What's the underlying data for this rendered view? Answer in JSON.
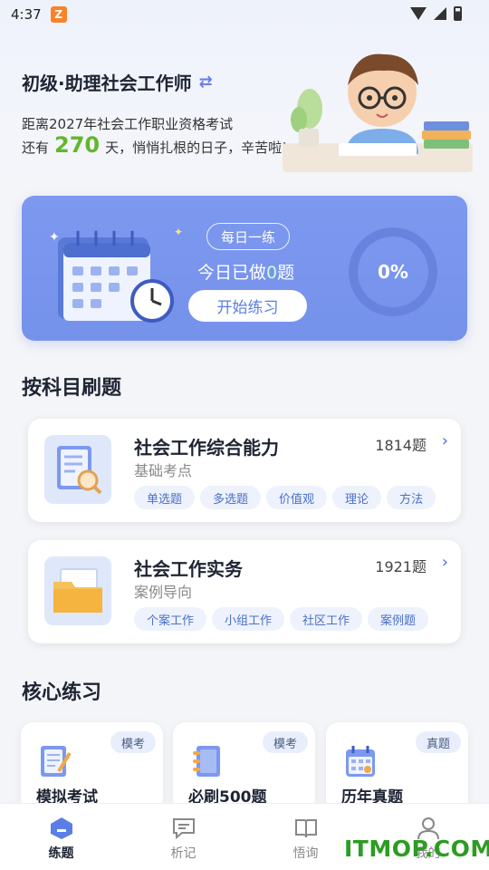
{
  "status": {
    "time": "4:37",
    "app_badge": "Z"
  },
  "header": {
    "exam_title": "初级·助理社会工作师",
    "countdown_prefix": "距离2027年社会工作职业资格考试",
    "remaining_prefix": "还有",
    "days": "270",
    "remaining_suffix": "天，悄悄扎根的日子，辛苦啦!"
  },
  "daily": {
    "tag": "每日一练",
    "done_prefix": "今日已做",
    "done_count": "0",
    "done_suffix": "题",
    "start_label": "开始练习",
    "progress_text": "0%",
    "progress": 0
  },
  "subjects_section": {
    "title": "按科目刷题"
  },
  "subjects": [
    {
      "name": "社会工作综合能力",
      "subtitle": "基础考点",
      "count": "1814题",
      "tags": [
        "单选题",
        "多选题",
        "价值观",
        "理论",
        "方法"
      ]
    },
    {
      "name": "社会工作实务",
      "subtitle": "案例导向",
      "count": "1921题",
      "tags": [
        "个案工作",
        "小组工作",
        "社区工作",
        "案例题"
      ]
    }
  ],
  "core_section": {
    "title": "核心练习"
  },
  "core": [
    {
      "badge": "模考",
      "label": "模拟考试",
      "icon": "exam-paper-icon"
    },
    {
      "badge": "模考",
      "label": "必刷500题",
      "icon": "notebook-icon"
    },
    {
      "badge": "真题",
      "label": "历年真题",
      "icon": "calendar-icon"
    }
  ],
  "nav": [
    {
      "label": "练题",
      "icon": "practice-icon",
      "active": true
    },
    {
      "label": "析记",
      "icon": "message-icon",
      "active": false
    },
    {
      "label": "悟询",
      "icon": "book-icon",
      "active": false
    },
    {
      "label": "我的",
      "icon": "user-icon",
      "active": false
    }
  ],
  "watermark": "ITMOP.COM",
  "colors": {
    "accent": "#7592eb",
    "days_green": "#62b72b",
    "tag_bg": "#edf2fc"
  }
}
